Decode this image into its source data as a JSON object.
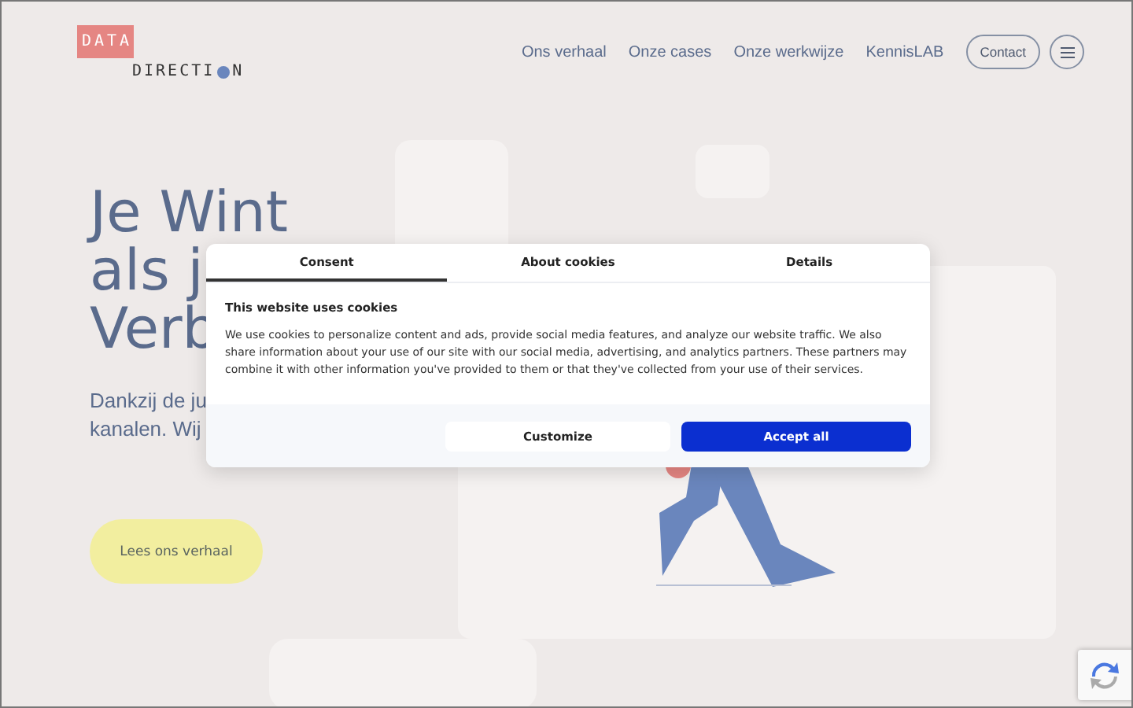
{
  "logo": {
    "top": "DATA",
    "bottom_start": "DIRECTI",
    "bottom_end": "N"
  },
  "nav": {
    "links": [
      {
        "label": "Ons verhaal"
      },
      {
        "label": "Onze cases"
      },
      {
        "label": "Onze werkwijze"
      },
      {
        "label": "KennisLAB"
      }
    ],
    "contact": "Contact"
  },
  "hero": {
    "heading_lines": [
      "Je Wint",
      "als j",
      "Verb"
    ],
    "intro_lines": [
      "Dankzij de ju",
      "kanalen. Wij"
    ],
    "button": "Lees ons verhaal"
  },
  "cookie_dialog": {
    "tabs": [
      {
        "label": "Consent",
        "selected": true
      },
      {
        "label": "About cookies",
        "selected": false
      },
      {
        "label": "Details",
        "selected": false
      }
    ],
    "title": "This website uses cookies",
    "text": "We use cookies to personalize content and ads, provide social media features, and analyze our website traffic. We also share information about your use of our site with our social media, advertising, and analytics partners. These partners may combine it with other information you've provided to them or that they've collected from your use of their services.",
    "buttons": [
      {
        "label": "Customize",
        "kind": "secondary"
      },
      {
        "label": "Accept all",
        "kind": "primary"
      }
    ]
  }
}
